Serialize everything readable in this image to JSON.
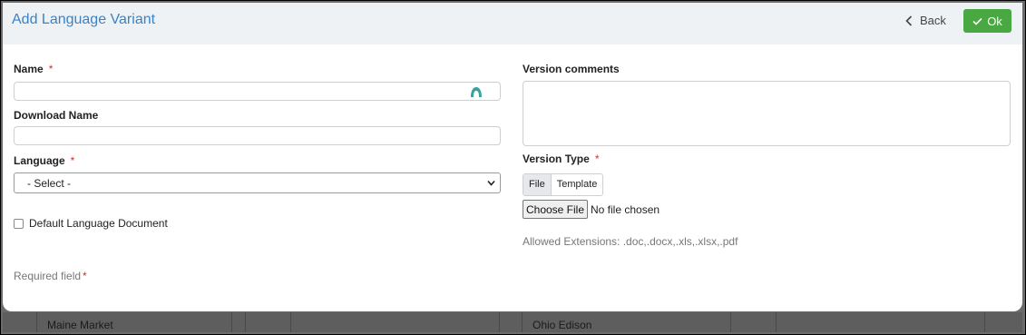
{
  "modal": {
    "title": "Add Language Variant",
    "back_label": "Back",
    "ok_label": "Ok"
  },
  "form": {
    "name_label": "Name",
    "download_name_label": "Download Name",
    "language_label": "Language",
    "language_selected": "- Select -",
    "default_doc_label": "Default Language Document",
    "required_note": "Required field",
    "required_marker": "*",
    "version_comments_label": "Version comments",
    "version_type_label": "Version Type",
    "version_type_options": [
      "File",
      "Template"
    ],
    "choose_file_label": "Choose File",
    "file_status": "No file chosen",
    "allowed_extensions": "Allowed Extensions: .doc,.docx,.xls,.xlsx,.pdf"
  },
  "background_table": {
    "cells": [
      "Maine Market",
      "Ohio Edison"
    ]
  },
  "colors": {
    "title": "#3b82c4",
    "ok_button": "#4aa843",
    "required": "#d0312d",
    "spinner": "#3aa3a0"
  },
  "icons": {
    "back": "chevron-left-icon",
    "ok": "check-icon",
    "name_field": "spinner-icon",
    "select": "chevron-down-icon"
  }
}
